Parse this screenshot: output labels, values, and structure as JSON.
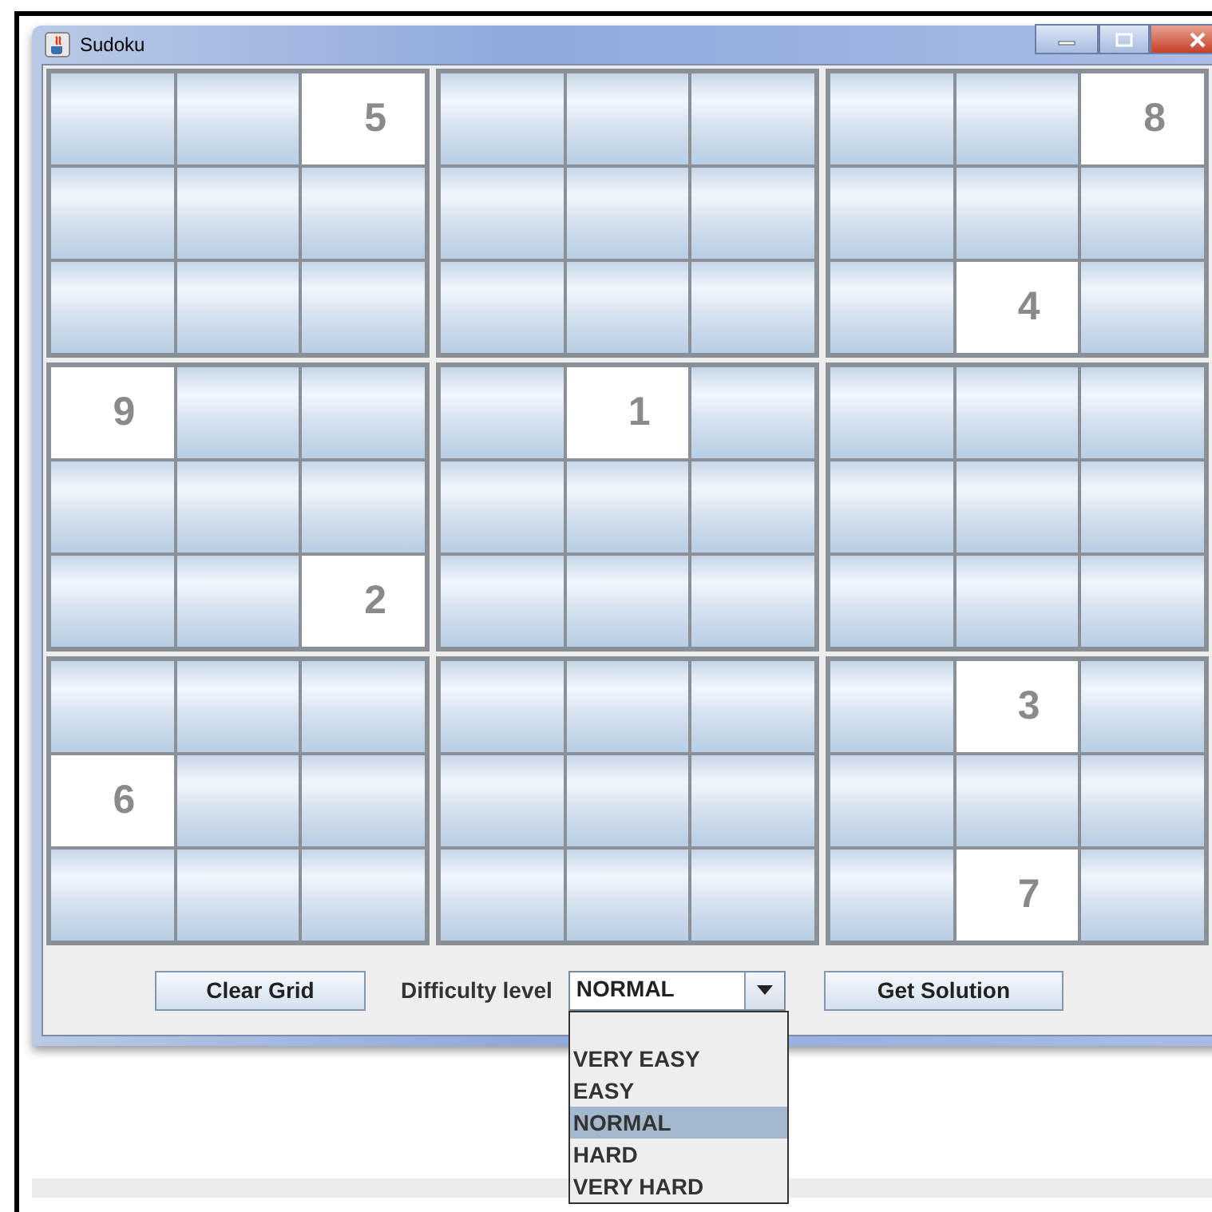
{
  "window": {
    "title": "Sudoku"
  },
  "grid": [
    [
      {
        "given": false
      },
      {
        "given": false
      },
      {
        "given": true,
        "value": "5"
      },
      {
        "given": false
      },
      {
        "given": false
      },
      {
        "given": false
      },
      {
        "given": false
      },
      {
        "given": false
      },
      {
        "given": true,
        "value": "8"
      }
    ],
    [
      {
        "given": false
      },
      {
        "given": false
      },
      {
        "given": false
      },
      {
        "given": false
      },
      {
        "given": false
      },
      {
        "given": false
      },
      {
        "given": false
      },
      {
        "given": false
      },
      {
        "given": false
      }
    ],
    [
      {
        "given": false
      },
      {
        "given": false
      },
      {
        "given": false
      },
      {
        "given": false
      },
      {
        "given": false
      },
      {
        "given": false
      },
      {
        "given": false
      },
      {
        "given": true,
        "value": "4"
      },
      {
        "given": false
      }
    ],
    [
      {
        "given": true,
        "value": "9"
      },
      {
        "given": false
      },
      {
        "given": false
      },
      {
        "given": false
      },
      {
        "given": true,
        "value": "1"
      },
      {
        "given": false
      },
      {
        "given": false
      },
      {
        "given": false
      },
      {
        "given": false
      }
    ],
    [
      {
        "given": false
      },
      {
        "given": false
      },
      {
        "given": false
      },
      {
        "given": false
      },
      {
        "given": false
      },
      {
        "given": false
      },
      {
        "given": false
      },
      {
        "given": false
      },
      {
        "given": false
      }
    ],
    [
      {
        "given": false
      },
      {
        "given": false
      },
      {
        "given": true,
        "value": "2"
      },
      {
        "given": false
      },
      {
        "given": false
      },
      {
        "given": false
      },
      {
        "given": false
      },
      {
        "given": false
      },
      {
        "given": false
      }
    ],
    [
      {
        "given": false
      },
      {
        "given": false
      },
      {
        "given": false
      },
      {
        "given": false
      },
      {
        "given": false
      },
      {
        "given": false
      },
      {
        "given": false
      },
      {
        "given": true,
        "value": "3"
      },
      {
        "given": false
      }
    ],
    [
      {
        "given": true,
        "value": "6"
      },
      {
        "given": false
      },
      {
        "given": false
      },
      {
        "given": false
      },
      {
        "given": false
      },
      {
        "given": false
      },
      {
        "given": false
      },
      {
        "given": false
      },
      {
        "given": false
      }
    ],
    [
      {
        "given": false
      },
      {
        "given": false
      },
      {
        "given": false
      },
      {
        "given": false
      },
      {
        "given": false
      },
      {
        "given": false
      },
      {
        "given": false
      },
      {
        "given": true,
        "value": "7"
      },
      {
        "given": false
      }
    ]
  ],
  "buttons": {
    "clear": "Clear Grid",
    "solve": "Get Solution"
  },
  "difficulty": {
    "label": "Difficulty level",
    "value": "NORMAL",
    "expanded": true,
    "options": [
      {
        "label": "VERY EASY",
        "selected": false
      },
      {
        "label": "EASY",
        "selected": false
      },
      {
        "label": "NORMAL",
        "selected": true
      },
      {
        "label": "HARD",
        "selected": false
      },
      {
        "label": "VERY HARD",
        "selected": false
      }
    ]
  }
}
